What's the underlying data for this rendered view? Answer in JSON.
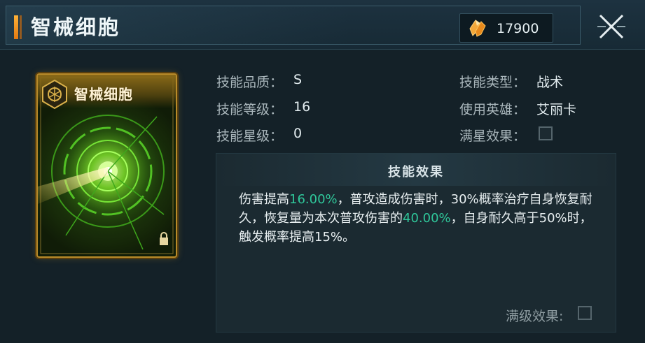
{
  "header": {
    "title": "智械细胞",
    "currency": {
      "icon": "crystal-icon",
      "value": "17900"
    },
    "close_icon": "close-icon"
  },
  "card": {
    "title": "智械细胞",
    "icons": [
      "hex-emblem-icon",
      "lock-icon"
    ]
  },
  "info": {
    "quality_label": "技能品质：",
    "quality_value": "S",
    "level_label": "技能等级：",
    "level_value": "16",
    "star_label": "技能星级：",
    "star_value": "0",
    "type_label": "技能类型：",
    "type_value": "战术",
    "hero_label": "使用英雄：",
    "hero_value": "艾丽卡",
    "maxstar_label": "满星效果："
  },
  "effect": {
    "title": "技能效果",
    "text_1": "伤害提高",
    "text_hl_1": "16.00%",
    "text_2": "，普攻造成伤害时，30%概率治疗自身恢复耐久，恢复量为本次普攻伤害的",
    "text_hl_2": "40.00%",
    "text_3": "，自身耐久高于50%时，触发概率提高15%。",
    "maxlevel_label": "满级效果:"
  },
  "colors": {
    "background": "#142128",
    "highlight": "#2fc79a",
    "accent": "#f0a030",
    "card_border": "#b98b2a"
  }
}
